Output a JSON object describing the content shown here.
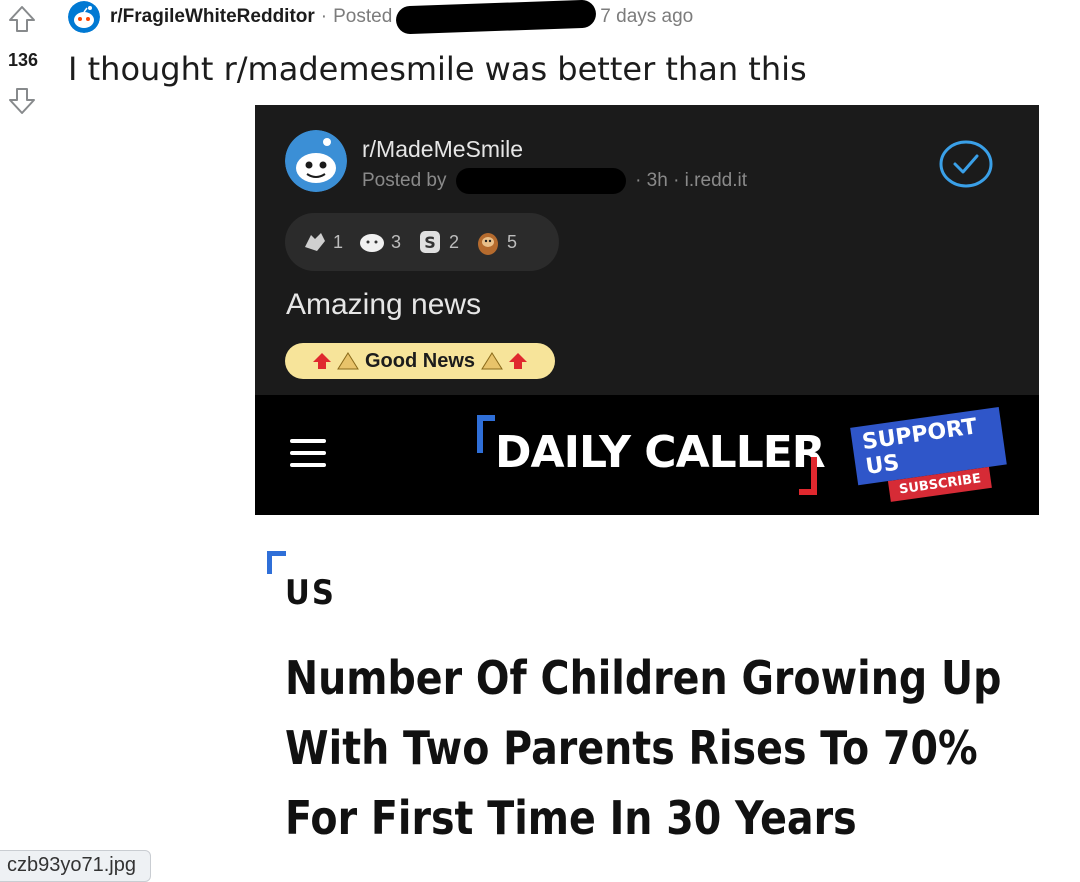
{
  "vote": {
    "score": "136"
  },
  "post": {
    "subreddit": "r/FragileWhiteRedditor",
    "separator": "·",
    "posted_prefix": "Posted",
    "time_ago": "7 days ago",
    "title": "I thought r/mademesmile was better than this"
  },
  "screenshot": {
    "subreddit": "r/MadeMeSmile",
    "posted_by": "Posted by",
    "meta": "· 3h · i.redd.it",
    "awards": [
      {
        "icon": "wholesome-hands-award-icon",
        "count": "1"
      },
      {
        "icon": "wholesome-face-award-icon",
        "count": "3"
      },
      {
        "icon": "silver-coin-award-icon",
        "count": "2"
      },
      {
        "icon": "sloth-award-icon",
        "count": "5"
      }
    ],
    "post_title": "Amazing news",
    "flair": "Good News",
    "site": {
      "logo": "DAILY CALLER",
      "support": "SUPPORT US",
      "subscribe": "SUBSCRIBE",
      "brand_blue": "#2f6fd8",
      "brand_red": "#e0282e"
    },
    "article": {
      "section": "US",
      "headline_lines": [
        "Number Of Children Growing Up",
        "With Two Parents Rises To 70%",
        "For First Time In 30 Years"
      ]
    }
  },
  "status": {
    "url": "czb93yo71.jpg"
  },
  "colors": {
    "reddit_orange": "#ff4500",
    "flair_bg": "#f7e49a",
    "dark_bg": "#1b1b1b",
    "verified_blue": "#3aa0e8"
  }
}
